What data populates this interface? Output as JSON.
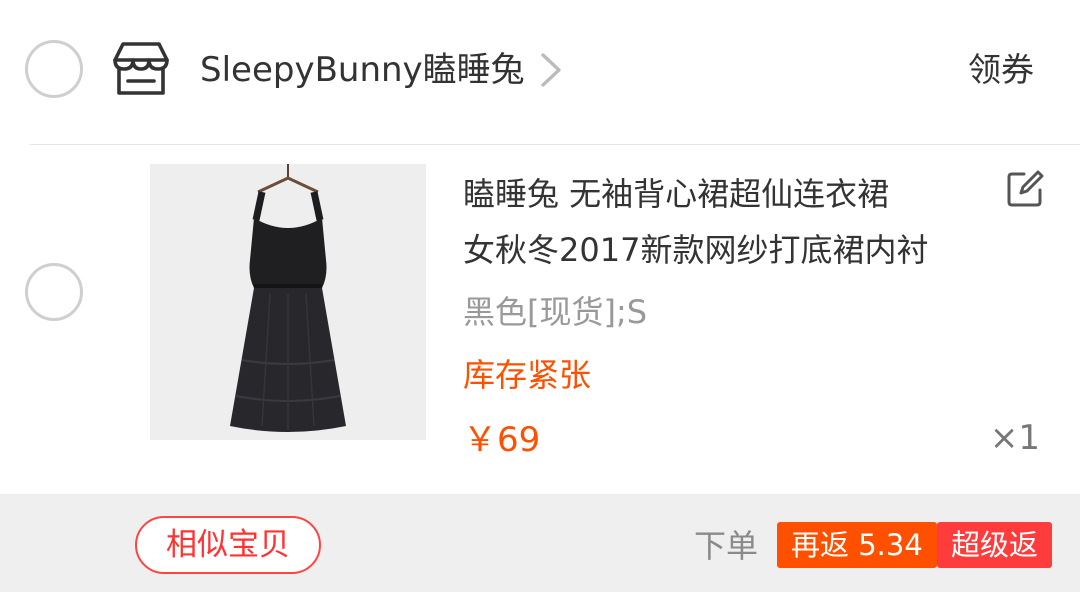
{
  "shop": {
    "name": "SleepyBunny瞌睡兔",
    "coupon_label": "领券"
  },
  "item": {
    "title_line1": "瞌睡兔 无袖背心裙超仙连衣裙",
    "title_line2": "女秋冬2017新款网纱打底裙内衬",
    "spec": "黑色[现货];S",
    "stock_status": "库存紧张",
    "price": "￥69",
    "quantity": "×1"
  },
  "footer": {
    "similar_label": "相似宝贝",
    "order_label": "下单",
    "rebate_badge": "再返 5.34",
    "super_badge": "超级返"
  },
  "colors": {
    "accent": "#ff5000",
    "badge_red": "#ff3c3c",
    "outline_red": "#ff4444"
  }
}
